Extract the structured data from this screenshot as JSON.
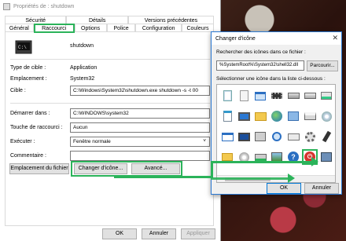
{
  "window1": {
    "title": "Propriétés de : shutdown",
    "tabs_row1": [
      "Sécurité",
      "Détails",
      "Versions précédentes"
    ],
    "tabs_row2": [
      "Général",
      "Raccourci",
      "Options",
      "Police",
      "Configuration",
      "Couleurs"
    ],
    "shortcut_name": "shutdown",
    "fields": {
      "type_label": "Type de cible :",
      "type_value": "Application",
      "location_label": "Emplacement :",
      "location_value": "System32",
      "target_label": "Cible :",
      "target_value": "C:\\Windows\\System32\\shutdown.exe shutdown -s -t 00",
      "start_label": "Démarrer dans :",
      "start_value": "C:\\WINDOWS\\system32",
      "hotkey_label": "Touche de raccourci :",
      "hotkey_value": "Aucun",
      "run_label": "Exécuter :",
      "run_value": "Fenêtre normale",
      "comment_label": "Commentaire :",
      "comment_value": ""
    },
    "buttons": {
      "open_location": "Emplacement du fichier",
      "change_icon": "Changer d'icône...",
      "advanced": "Avancé...",
      "ok": "OK",
      "cancel": "Annuler",
      "apply": "Appliquer"
    }
  },
  "window2": {
    "title": "Changer d'icône",
    "search_label": "Rechercher des icônes dans ce fichier :",
    "path_value": "%SystemRoot%\\System32\\shell32.dll",
    "browse": "Parcourir...",
    "select_label": "Sélectionner une icône dans la liste ci-dessous :",
    "ok": "OK",
    "cancel": "Annuler"
  },
  "colors": {
    "highlight": "#2bb35a",
    "accent": "#2b78d2"
  }
}
